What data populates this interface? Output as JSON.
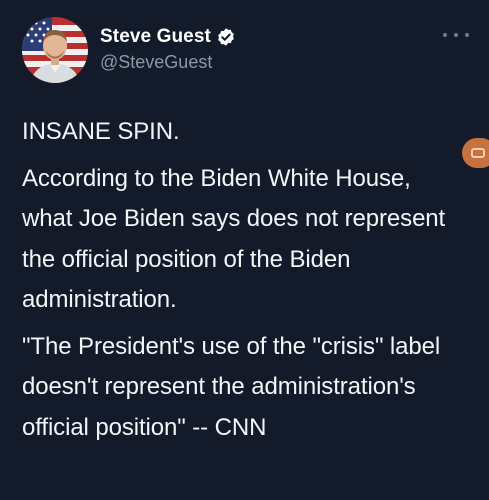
{
  "tweet": {
    "author": {
      "display_name": "Steve Guest",
      "handle": "@SteveGuest",
      "verified": true,
      "avatar_icon": "profile-photo-flag-background"
    },
    "more_icon": "ellipsis-icon",
    "paragraphs": [
      "INSANE SPIN.",
      "According to the Biden White House, what Joe Biden says does not represent the official position of the Biden administration.",
      "\"The President's use of the \"crisis\" label doesn't represent the administration's official position\" -- CNN"
    ]
  },
  "overlay": {
    "edge_badge_icon": "video-camera-icon",
    "badge_color": "#c7713d"
  },
  "colors": {
    "background": "#131a2a",
    "text": "#f3f5f7",
    "secondary_text": "#8b98a5",
    "verified_badge": "#ffffff"
  }
}
